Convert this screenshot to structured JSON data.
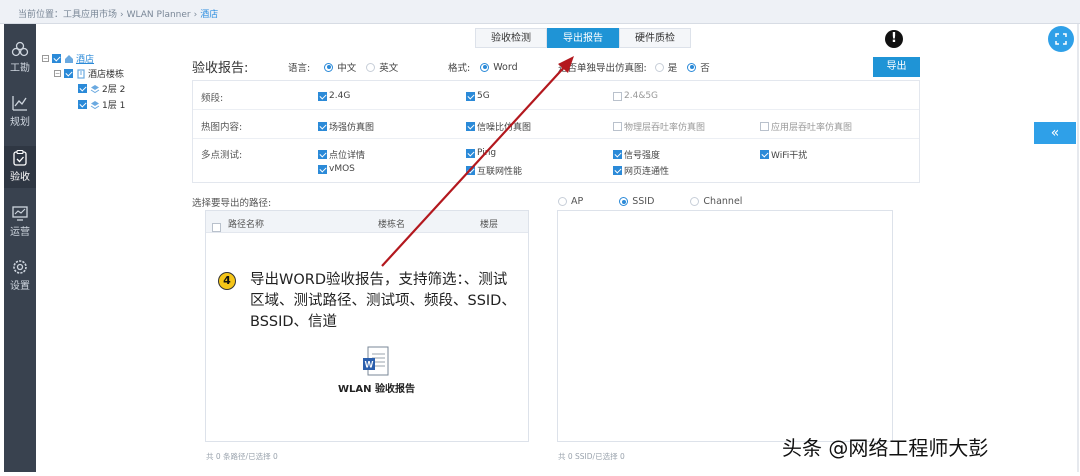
{
  "breadcrumb": {
    "prefix": "当前位置：",
    "items": [
      "工具应用市场",
      "WLAN Planner",
      "酒店"
    ],
    "separator": "›"
  },
  "sidebar": {
    "items": [
      {
        "label": "工勘",
        "icon": "survey-icon"
      },
      {
        "label": "规划",
        "icon": "planning-icon"
      },
      {
        "label": "验收",
        "icon": "acceptance-icon",
        "active": true
      },
      {
        "label": "运营",
        "icon": "operations-icon"
      },
      {
        "label": "设置",
        "icon": "settings-icon"
      }
    ]
  },
  "tree": {
    "root": "酒店",
    "building": "酒店楼栋",
    "floors": [
      "2层 2",
      "1层 1"
    ]
  },
  "tabs": [
    {
      "label": "验收检测",
      "active": false
    },
    {
      "label": "导出报告",
      "active": true
    },
    {
      "label": "硬件质检",
      "active": false
    }
  ],
  "annotation_mark": "!",
  "report": {
    "title": "验收报告:",
    "language_label": "语言:",
    "language_options": [
      "中文",
      "英文"
    ],
    "language_selected": "中文",
    "format_label": "格式:",
    "format_options": [
      "Word"
    ],
    "format_selected": "Word",
    "separate_label": "是否单独导出仿真图:",
    "separate_options": [
      "是",
      "否"
    ],
    "separate_selected": "否",
    "export_button": "导出"
  },
  "options": {
    "band": {
      "label": "频段:",
      "items": [
        {
          "text": "2.4G",
          "checked": true
        },
        {
          "text": "5G",
          "checked": true
        },
        {
          "text": "2.4&5G",
          "checked": false
        }
      ]
    },
    "heatmap": {
      "label": "热图内容:",
      "items": [
        {
          "text": "场强仿真图",
          "checked": true
        },
        {
          "text": "信噪比仿真图",
          "checked": true
        },
        {
          "text": "物理层吞吐率仿真图",
          "checked": false
        },
        {
          "text": "应用层吞吐率仿真图",
          "checked": false
        }
      ]
    },
    "multipoint": {
      "label": "多点测试:",
      "items": [
        {
          "text": "点位详情",
          "checked": true
        },
        {
          "text": "Ping",
          "checked": true
        },
        {
          "text": "信号强度",
          "checked": true
        },
        {
          "text": "WiFi干扰",
          "checked": true
        },
        {
          "text": "vMOS",
          "checked": true
        },
        {
          "text": "互联网性能",
          "checked": true
        },
        {
          "text": "网页连通性",
          "checked": true
        }
      ]
    }
  },
  "path_section": {
    "title": "选择要导出的路径:",
    "columns": [
      "路径名称",
      "楼栋名",
      "楼层"
    ],
    "footer": "共 0 条路径/已选择 0"
  },
  "filter": {
    "options": [
      "AP",
      "SSID",
      "Channel"
    ],
    "selected": "SSID",
    "footer": "共 0 SSID/已选择 0"
  },
  "callout": {
    "number": "4",
    "text": "导出WORD验收报告，支持筛选：、测试区域、测试路径、测试项、频段、SSID、BSSID、信道",
    "doc_label": "WLAN 验收报告"
  },
  "watermark": "头条 @网络工程师大彭",
  "colors": {
    "accent": "#1f94d6",
    "sidebar": "#39424f",
    "arrow": "#b3181e",
    "badge": "#f5c518"
  }
}
